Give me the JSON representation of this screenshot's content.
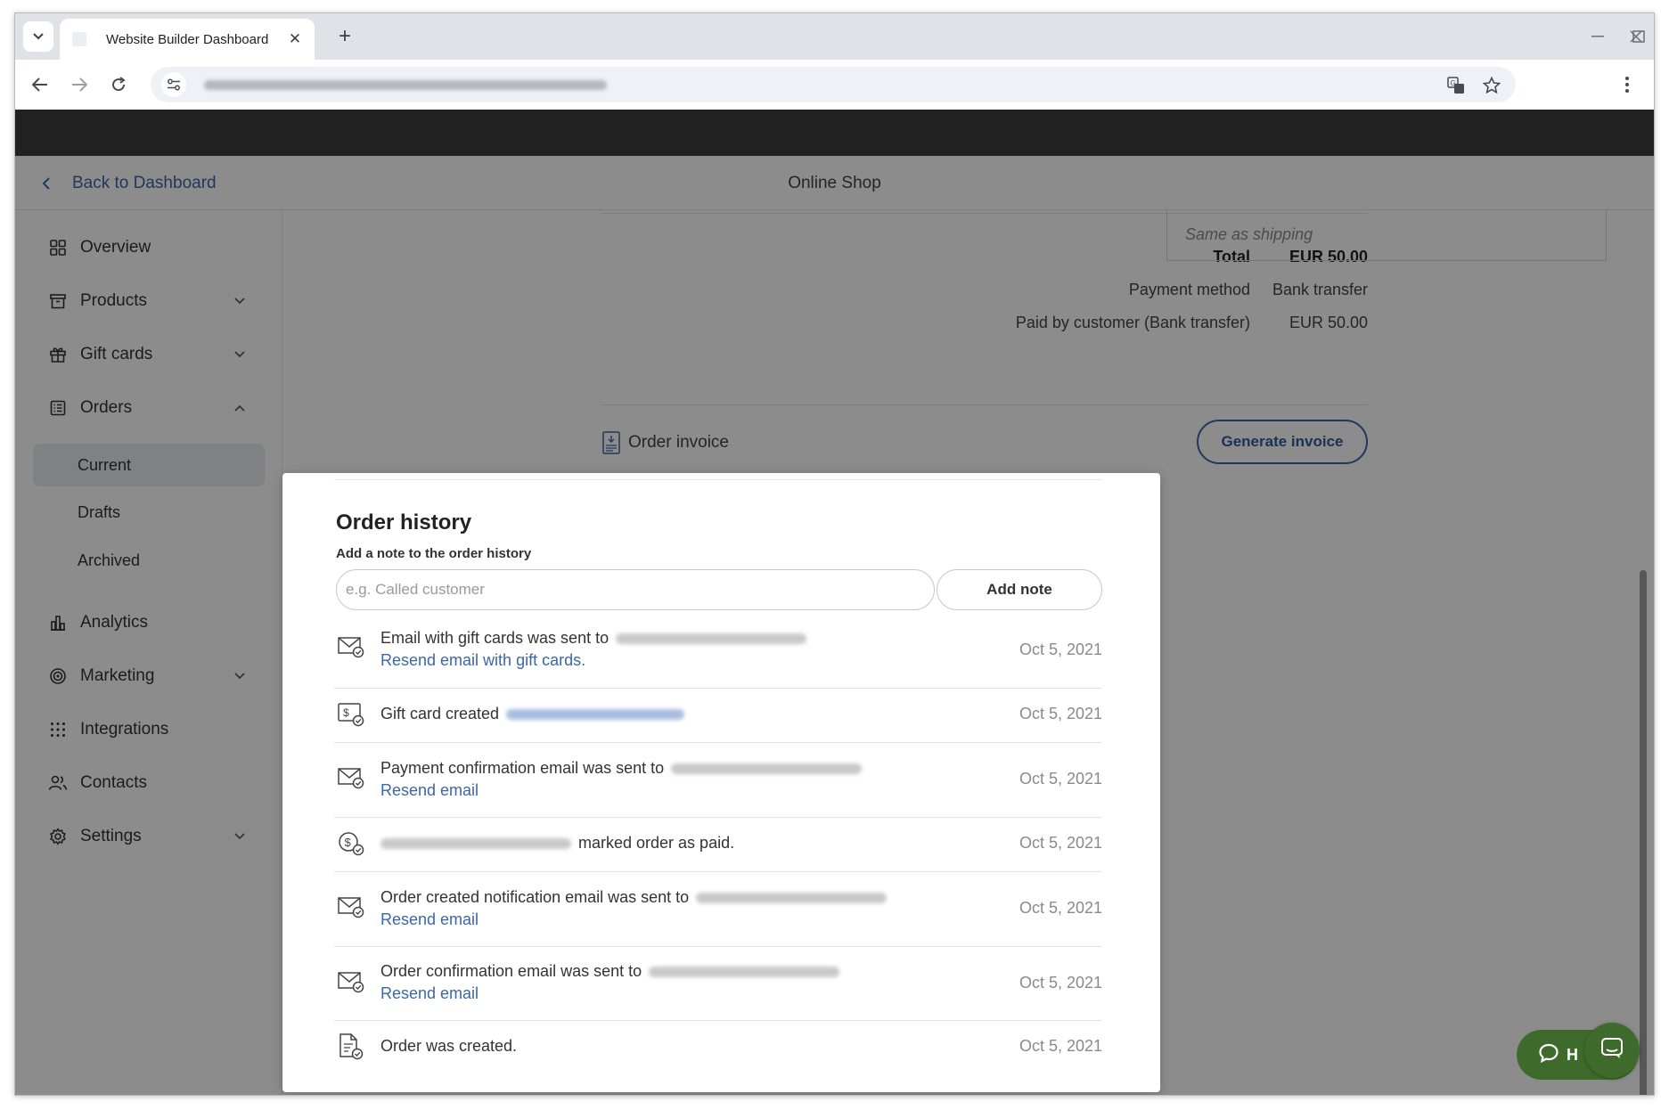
{
  "browser": {
    "tab_title": "Website Builder Dashboard",
    "new_tab_symbol": "+",
    "close_symbol": "✕"
  },
  "header": {
    "back_label": "Back to Dashboard",
    "page_title": "Online Shop"
  },
  "sidebar": {
    "items": [
      {
        "label": "Overview",
        "icon": "grid-icon"
      },
      {
        "label": "Products",
        "icon": "box-icon"
      },
      {
        "label": "Gift cards",
        "icon": "gift-icon"
      },
      {
        "label": "Orders",
        "icon": "list-icon"
      },
      {
        "label": "Analytics",
        "icon": "bar-chart-icon"
      },
      {
        "label": "Marketing",
        "icon": "target-icon"
      },
      {
        "label": "Integrations",
        "icon": "dots-grid-icon"
      },
      {
        "label": "Contacts",
        "icon": "people-icon"
      },
      {
        "label": "Settings",
        "icon": "gear-icon"
      }
    ],
    "orders_sub": [
      {
        "label": "Current",
        "active": true
      },
      {
        "label": "Drafts"
      },
      {
        "label": "Archived"
      }
    ]
  },
  "summary": {
    "total_label": "Total",
    "total_value": "EUR 50.00",
    "payment_method_label": "Payment method",
    "payment_method_value": "Bank transfer",
    "paid_label": "Paid by customer (Bank transfer)",
    "paid_value": "EUR 50.00"
  },
  "billing": {
    "placeholder": "Same as shipping"
  },
  "invoice": {
    "label": "Order invoice",
    "button": "Generate invoice"
  },
  "history": {
    "title": "Order history",
    "note_label": "Add a note to the order history",
    "note_placeholder": "e.g. Called customer",
    "add_note_button": "Add note",
    "entries": [
      {
        "text": "Email with gift cards was sent to",
        "link": "Resend email with gift cards.",
        "date": "Oct 5, 2021",
        "icon": "mail-check-icon"
      },
      {
        "text": "Gift card created",
        "date": "Oct 5, 2021",
        "icon": "gift-card-icon"
      },
      {
        "text": "Payment confirmation email was sent to",
        "link": "Resend email",
        "date": "Oct 5, 2021",
        "icon": "mail-check-icon"
      },
      {
        "text": "marked order as paid.",
        "date": "Oct 5, 2021",
        "icon": "coin-check-icon"
      },
      {
        "text": "Order created notification email was sent to",
        "link": "Resend email",
        "date": "Oct 5, 2021",
        "icon": "mail-check-icon"
      },
      {
        "text": "Order confirmation email was sent to",
        "link": "Resend email",
        "date": "Oct 5, 2021",
        "icon": "mail-check-icon"
      },
      {
        "text": "Order was created.",
        "date": "Oct 5, 2021",
        "icon": "document-check-icon"
      }
    ]
  },
  "chat": {
    "label": "H"
  },
  "colors": {
    "accent": "#3b67a7",
    "chat_green": "#3e6b2b",
    "app_bar": "#3c3c3c"
  }
}
